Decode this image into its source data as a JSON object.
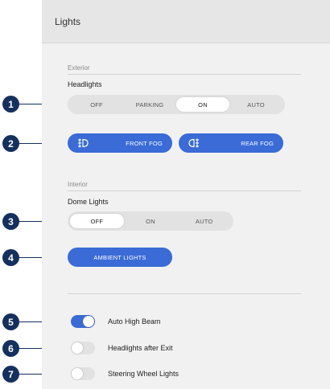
{
  "header": {
    "title": "Lights"
  },
  "exterior": {
    "section_label": "Exterior",
    "headlights": {
      "title": "Headlights",
      "options": [
        "OFF",
        "PARKING",
        "ON",
        "AUTO"
      ],
      "selected": "ON"
    },
    "front_fog": {
      "label": "FRONT FOG",
      "icon": "front-fog-icon"
    },
    "rear_fog": {
      "label": "REAR FOG",
      "icon": "rear-fog-icon"
    }
  },
  "interior": {
    "section_label": "Interior",
    "dome_lights": {
      "title": "Dome Lights",
      "options": [
        "OFF",
        "ON",
        "AUTO"
      ],
      "selected": "OFF"
    },
    "ambient": {
      "label": "AMBIENT LIGHTS"
    }
  },
  "toggles": [
    {
      "label": "Auto High Beam",
      "on": true
    },
    {
      "label": "Headlights after Exit",
      "on": false
    },
    {
      "label": "Steering Wheel Lights",
      "on": false
    }
  ],
  "callouts": [
    "1",
    "2",
    "3",
    "4",
    "5",
    "6",
    "7"
  ],
  "colors": {
    "accent": "#3a6bd6",
    "callout": "#14305e"
  }
}
